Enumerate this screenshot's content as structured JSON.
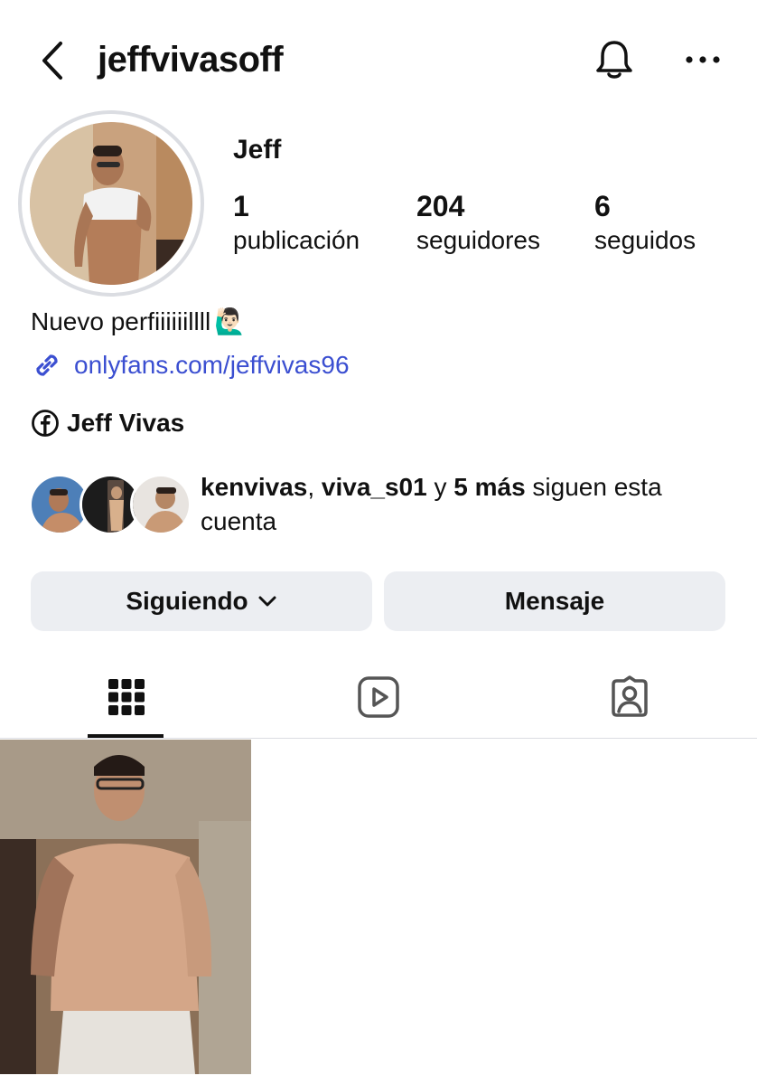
{
  "header": {
    "username": "jeffvivasoff"
  },
  "profile": {
    "display_name": "Jeff",
    "stats": [
      {
        "value": "1",
        "label": "publicación"
      },
      {
        "value": "204",
        "label": "seguidores"
      },
      {
        "value": "6",
        "label": "seguidos"
      }
    ],
    "bio": "Nuevo perfiiiiiillll",
    "bio_emoji": "🙋🏻‍♂️",
    "link": "onlyfans.com/jeffvivas96",
    "facebook_name": "Jeff Vivas"
  },
  "followed_by": {
    "user1": "kenvivas",
    "separator": ", ",
    "user2": "viva_s01",
    "connector": " y ",
    "more": "5 más",
    "suffix": " siguen esta cuenta"
  },
  "actions": {
    "following_label": "Siguiendo",
    "message_label": "Mensaje"
  },
  "tabs": [
    {
      "icon": "grid-icon",
      "selected": true
    },
    {
      "icon": "reels-icon",
      "selected": false
    },
    {
      "icon": "tagged-icon",
      "selected": false
    }
  ],
  "colors": {
    "link": "#3b4fd1",
    "button_bg": "#eceef2",
    "avatar_ring": "#dbdde2"
  }
}
